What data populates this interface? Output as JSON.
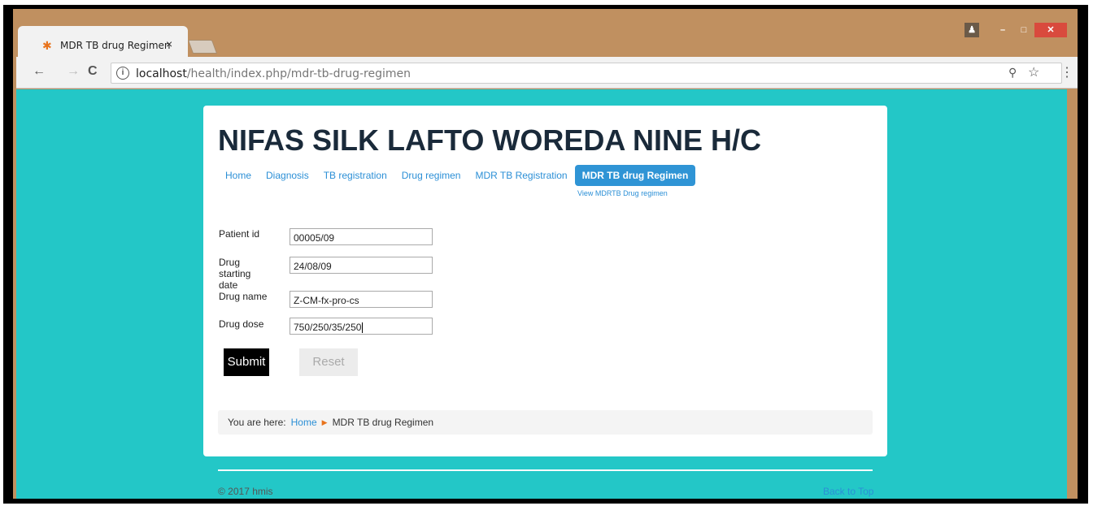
{
  "browser": {
    "tab_title": "MDR TB drug Regimen",
    "tab_close": "×",
    "url_host": "localhost",
    "url_path": "/health/index.php/mdr-tb-drug-regimen",
    "icons": {
      "back": "←",
      "forward": "→",
      "reload": "C",
      "info": "i",
      "zoom": "⚲",
      "star": "☆",
      "menu": "⋮",
      "user": "♟",
      "minimize": "–",
      "maximize": "□",
      "close": "✕"
    }
  },
  "site": {
    "title": "NIFAS SILK LAFTO WOREDA NINE H/C",
    "menu": [
      {
        "label": "Home",
        "active": false
      },
      {
        "label": "Diagnosis",
        "active": false
      },
      {
        "label": "TB registration",
        "active": false
      },
      {
        "label": "Drug regimen",
        "active": false
      },
      {
        "label": "MDR TB Registration",
        "active": false
      },
      {
        "label": "MDR TB drug Regimen",
        "active": true
      }
    ],
    "submenu": "View MDRTB Drug regimen"
  },
  "form": {
    "patient_id_label": "Patient id",
    "patient_id_value": "00005/09",
    "start_date_label": "Drug starting date",
    "start_date_value": "24/08/09",
    "drug_name_label": "Drug name",
    "drug_name_value": "Z-CM-fx-pro-cs",
    "drug_dose_label": "Drug dose",
    "drug_dose_value": "750/250/35/250",
    "submit_label": "Submit",
    "reset_label": "Reset"
  },
  "breadcrumb": {
    "prefix": "You are here:",
    "home": "Home",
    "separator": "▶",
    "current": "MDR TB drug Regimen"
  },
  "footer": {
    "copyright": "© 2017 hmis",
    "back_to_top": "Back to Top"
  },
  "colors": {
    "page_bg": "#23c7c7",
    "link": "#2b8fd6",
    "active_menu": "#2f94d5",
    "browser_frame": "#c09060"
  }
}
